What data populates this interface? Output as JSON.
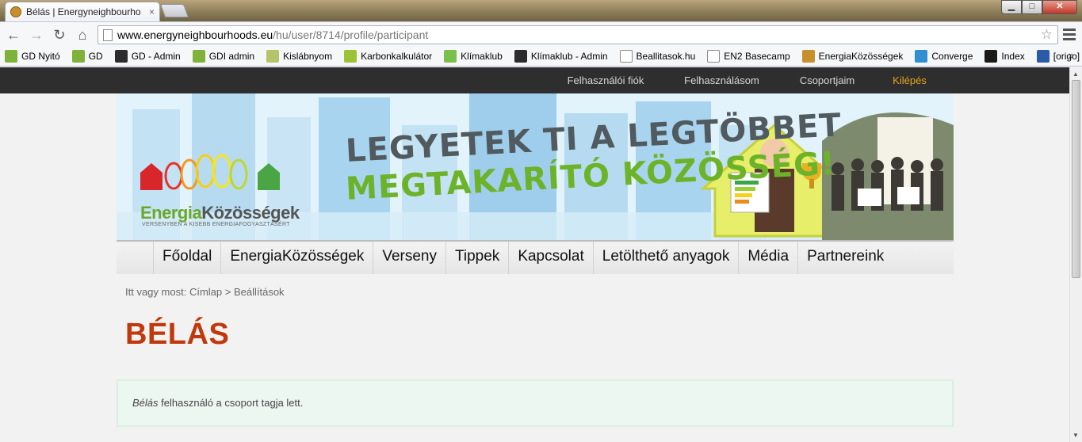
{
  "browser": {
    "tab_title": "Bélás | Energyneighbourho",
    "tab_close": "×",
    "window_buttons": {
      "minimize": "▁",
      "maximize": "□",
      "close": "✕"
    },
    "url_host": "www.energyneighbourhoods.eu",
    "url_path": "/hu/user/8714/profile/participant",
    "nav_icons": {
      "back": "←",
      "forward": "→",
      "reload": "↻",
      "home": "⌂",
      "star": "☆"
    },
    "bookmarks": [
      {
        "label": "GD Nyitó",
        "icon": "gd-icon",
        "color": "#7fb23b"
      },
      {
        "label": "GD",
        "icon": "gd-icon",
        "color": "#7fb23b"
      },
      {
        "label": "GD - Admin",
        "icon": "joomla-icon",
        "color": "#2c2c2c"
      },
      {
        "label": "GDI admin",
        "icon": "gd-icon",
        "color": "#7fb23b"
      },
      {
        "label": "Kislábnyom",
        "icon": "footprint-icon",
        "color": "#b5c46a"
      },
      {
        "label": "Karbonkalkulátor",
        "icon": "co2-icon",
        "color": "#9cc236"
      },
      {
        "label": "Klímaklub",
        "icon": "leaf-icon",
        "color": "#7cbf4b"
      },
      {
        "label": "Klímaklub - Admin",
        "icon": "joomla-icon",
        "color": "#2c2c2c"
      },
      {
        "label": "Beallitasok.hu",
        "icon": "page-icon",
        "color": "#ffffff"
      },
      {
        "label": "EN2 Basecamp",
        "icon": "page-icon",
        "color": "#ffffff"
      },
      {
        "label": "EnergiaKözösségek",
        "icon": "en2-icon",
        "color": "#c8902c"
      },
      {
        "label": "Converge",
        "icon": "drupal-icon",
        "color": "#2f8fd1"
      },
      {
        "label": "Index",
        "icon": "index-icon",
        "color": "#1a1a1a"
      },
      {
        "label": "[origo]",
        "icon": "origo-icon",
        "color": "#2a5aa8"
      }
    ],
    "bookmarks_more": "»"
  },
  "topbar": {
    "links": [
      {
        "label": "Felhasználói fiók"
      },
      {
        "label": "Felhasználásom"
      },
      {
        "label": "Csoportjaim"
      },
      {
        "label": "Kilépés"
      }
    ]
  },
  "banner": {
    "logo_energia": "Energia",
    "logo_kozossegek": "Közösségek",
    "logo_tagline": "VERSENYBEN A KISEBB ENERGIAFOGYASZTÁSÉRT",
    "slogan_line1": "LEGYETEK TI A LEGTÖBBET",
    "slogan_line2": "MEGTAKARÍTÓ KÖZÖSSÉG!"
  },
  "mainnav": {
    "items": [
      "Főoldal",
      "EnergiaKözösségek",
      "Verseny",
      "Tippek",
      "Kapcsolat",
      "Letölthető anyagok",
      "Média",
      "Partnereink"
    ]
  },
  "breadcrumb": {
    "prefix": "Itt vagy most:",
    "home": "Címlap",
    "separator": ">",
    "current": "Beállítások"
  },
  "page": {
    "title": "BÉLÁS",
    "message_name": "Bélás",
    "message_text": "felhasználó a csoport tagja lett."
  },
  "colors": {
    "topbar": "#2e2e2e",
    "logout": "#e6a51c",
    "title": "#c0390d",
    "message_bg": "#edf7f2"
  }
}
